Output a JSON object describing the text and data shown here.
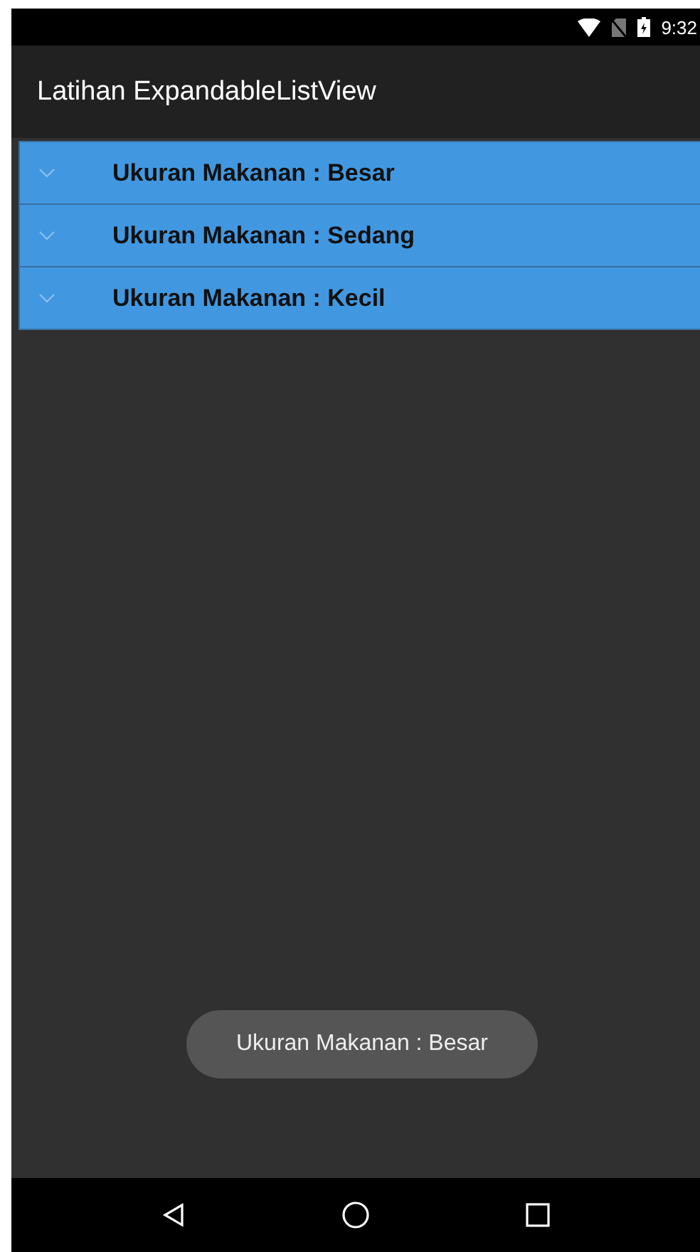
{
  "status_bar": {
    "time": "9:32"
  },
  "app_bar": {
    "title": "Latihan ExpandableListView"
  },
  "groups": [
    {
      "label": "Ukuran Makanan : Besar",
      "expanded": false
    },
    {
      "label": "Ukuran Makanan : Sedang",
      "expanded": false
    },
    {
      "label": "Ukuran Makanan : Kecil",
      "expanded": false
    }
  ],
  "toast": {
    "text": "Ukuran Makanan : Besar"
  }
}
